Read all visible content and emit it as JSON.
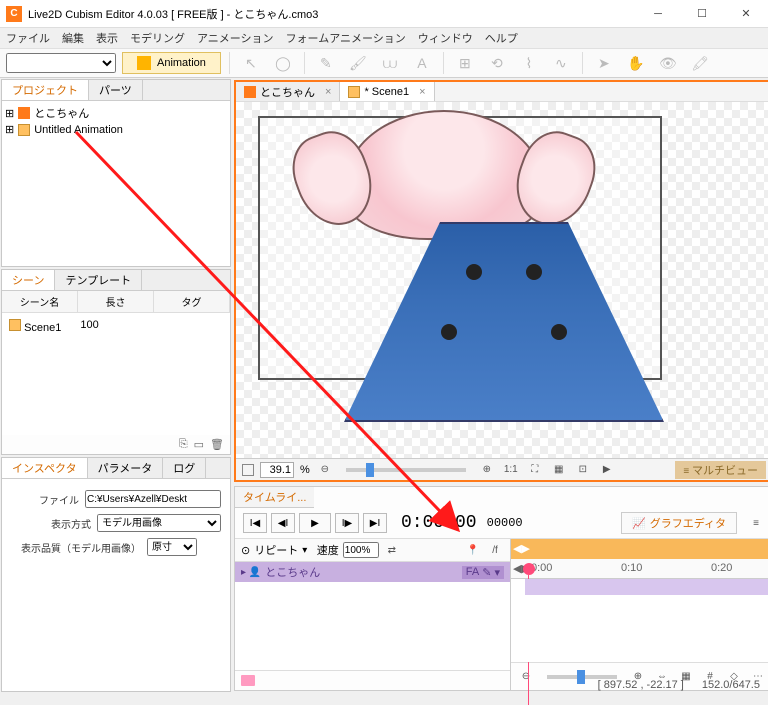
{
  "title": "Live2D Cubism Editor 4.0.03    [ FREE版 ]  - とこちゃん.cmo3",
  "menus": [
    "ファイル",
    "編集",
    "表示",
    "モデリング",
    "アニメーション",
    "フォームアニメーション",
    "ウィンドウ",
    "ヘルプ"
  ],
  "mode_button": "Animation",
  "project_panel": {
    "tabs": [
      "プロジェクト",
      "パーツ"
    ],
    "items": [
      {
        "icon": "m",
        "label": "とこちゃん"
      },
      {
        "icon": "a",
        "label": "Untitled Animation"
      }
    ]
  },
  "scene_panel": {
    "tabs": [
      "シーン",
      "テンプレート"
    ],
    "columns": [
      "シーン名",
      "長さ",
      "タグ"
    ],
    "rows": [
      {
        "name": "Scene1",
        "length": "100",
        "tag": ""
      }
    ]
  },
  "inspector_panel": {
    "tabs": [
      "インスペクタ",
      "パラメータ",
      "ログ"
    ],
    "file_label": "ファイル",
    "file_value": "C:¥Users¥Azell¥Deskt",
    "display_label": "表示方式",
    "display_value": "モデル用画像",
    "quality_label": "表示品質（モデル用画像）",
    "quality_value": "原寸"
  },
  "canvas": {
    "tabs": [
      {
        "icon": "m",
        "label": "とこちゃん",
        "dirty": false
      },
      {
        "icon": "a",
        "label": "* Scene1",
        "dirty": true
      }
    ],
    "zoom_value": "39.1",
    "zoom_pct": "%",
    "ratio": "1:1",
    "multiview": "マルチビュー"
  },
  "timeline": {
    "tab": "タイムライ...",
    "graph_tab": "グラフエディタ",
    "timecode": "0:00:00",
    "frames": "00000",
    "repeat_label": "リピート",
    "speed_label": "速度",
    "speed_value": "100%",
    "track_name": "とこちゃん",
    "ticks": [
      "0:00",
      "0:10",
      "0:20"
    ],
    "fa_label": "FA"
  },
  "status": {
    "cursor": "[ 897.52 , -22.17 ]",
    "doc": "152.0/647.5"
  },
  "icons": {
    "expand": "⊞",
    "play": "▶",
    "stepb": "I◀",
    "prev": "◀I",
    "next": "I▶",
    "stepf": "▶I",
    "zoomout": "⊖",
    "zoomin": "⊕",
    "fit": "⛶",
    "grid": "▦",
    "eye": "👁"
  }
}
